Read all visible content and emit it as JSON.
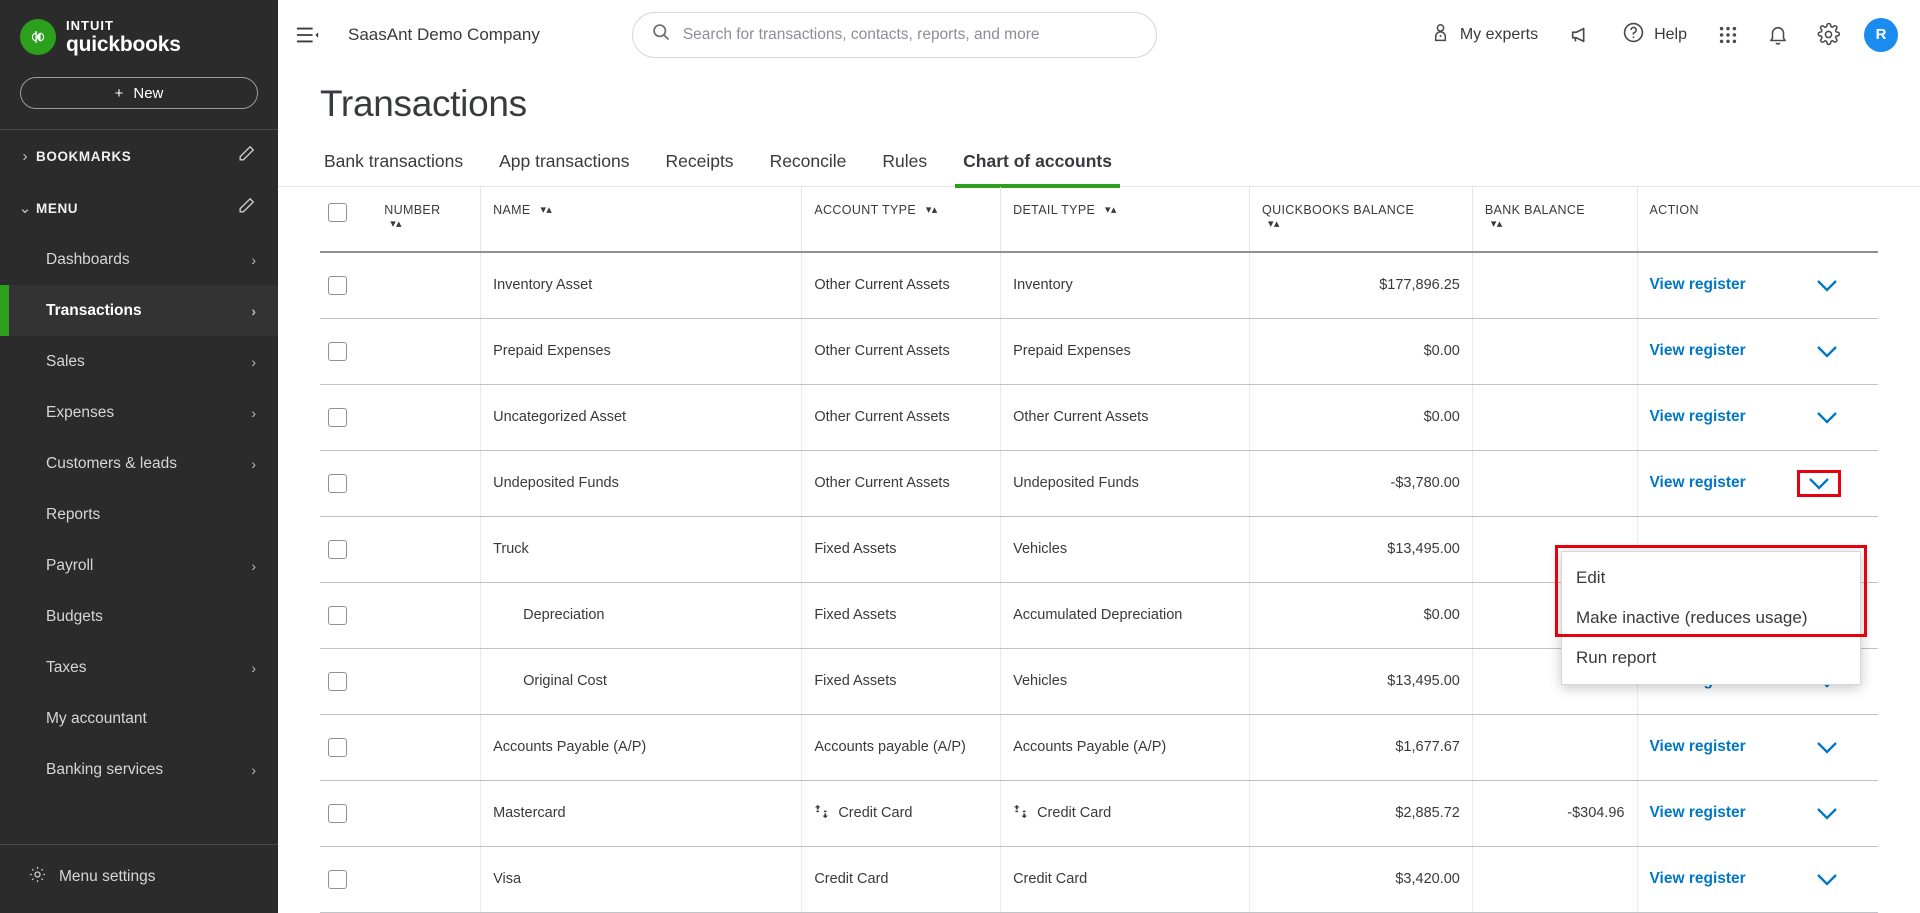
{
  "sidebar": {
    "brand": {
      "intuit": "INTUIT",
      "product": "quickbooks"
    },
    "new_button": "New",
    "groups": [
      {
        "label": "BOOKMARKS",
        "expanded": false,
        "icon": "chevron-right-icon",
        "edit_icon": "pencil-icon"
      },
      {
        "label": "MENU",
        "expanded": true,
        "icon": "chevron-down-icon",
        "edit_icon": "pencil-icon"
      }
    ],
    "items": [
      {
        "label": "Dashboards",
        "active": false,
        "has_chevron": true
      },
      {
        "label": "Transactions",
        "active": true,
        "has_chevron": true
      },
      {
        "label": "Sales",
        "active": false,
        "has_chevron": true
      },
      {
        "label": "Expenses",
        "active": false,
        "has_chevron": true
      },
      {
        "label": "Customers & leads",
        "active": false,
        "has_chevron": true
      },
      {
        "label": "Reports",
        "active": false,
        "has_chevron": false
      },
      {
        "label": "Payroll",
        "active": false,
        "has_chevron": true
      },
      {
        "label": "Budgets",
        "active": false,
        "has_chevron": false
      },
      {
        "label": "Taxes",
        "active": false,
        "has_chevron": true
      },
      {
        "label": "My accountant",
        "active": false,
        "has_chevron": false
      },
      {
        "label": "Banking services",
        "active": false,
        "has_chevron": true
      }
    ],
    "footer": {
      "label": "Menu settings",
      "icon": "gear-icon"
    },
    "accent_color": "#2CA01C",
    "background_color": "#2b2b2b"
  },
  "topbar": {
    "menu_toggle_icon": "hamburger-collapse-icon",
    "company_name": "SaasAnt Demo Company",
    "search": {
      "placeholder": "Search for transactions, contacts, reports, and more",
      "value": "",
      "icon": "search-icon"
    },
    "my_experts": {
      "label": "My experts",
      "icon": "person-icon"
    },
    "megaphone_icon": "megaphone-icon",
    "help": {
      "label": "Help",
      "icon": "question-circle-icon"
    },
    "apps_icon": "grid-apps-icon",
    "notifications_icon": "bell-icon",
    "settings_icon": "gear-icon",
    "avatar": {
      "initial": "R",
      "color": "#1a8cf0"
    }
  },
  "page": {
    "title": "Transactions"
  },
  "tabs": [
    {
      "label": "Bank transactions",
      "active": false
    },
    {
      "label": "App transactions",
      "active": false
    },
    {
      "label": "Receipts",
      "active": false
    },
    {
      "label": "Reconcile",
      "active": false
    },
    {
      "label": "Rules",
      "active": false
    },
    {
      "label": "Chart of accounts",
      "active": true
    }
  ],
  "table": {
    "select_all_checkbox": false,
    "columns": [
      {
        "key": "checkbox",
        "label": ""
      },
      {
        "key": "number",
        "label": "NUMBER",
        "sortable": true
      },
      {
        "key": "name",
        "label": "NAME",
        "sortable": true
      },
      {
        "key": "account_type",
        "label": "ACCOUNT TYPE",
        "sortable": true
      },
      {
        "key": "detail_type",
        "label": "DETAIL TYPE",
        "sortable": true
      },
      {
        "key": "quickbooks_balance",
        "label": "QUICKBOOKS BALANCE",
        "sortable": true
      },
      {
        "key": "bank_balance",
        "label": "BANK BALANCE",
        "sortable": true
      },
      {
        "key": "action",
        "label": "ACTION",
        "sortable": false
      }
    ],
    "action_link_label": "View register",
    "rows": [
      {
        "number": "",
        "name": "Inventory Asset",
        "indent": false,
        "account_type": "Other Current Assets",
        "account_type_icon": "",
        "detail_type": "Inventory",
        "detail_type_icon": "",
        "quickbooks_balance": "$177,896.25",
        "bank_balance": ""
      },
      {
        "number": "",
        "name": "Prepaid Expenses",
        "indent": false,
        "account_type": "Other Current Assets",
        "account_type_icon": "",
        "detail_type": "Prepaid Expenses",
        "detail_type_icon": "",
        "quickbooks_balance": "$0.00",
        "bank_balance": ""
      },
      {
        "number": "",
        "name": "Uncategorized Asset",
        "indent": false,
        "account_type": "Other Current Assets",
        "account_type_icon": "",
        "detail_type": "Other Current Assets",
        "detail_type_icon": "",
        "quickbooks_balance": "$0.00",
        "bank_balance": ""
      },
      {
        "number": "",
        "name": "Undeposited Funds",
        "indent": false,
        "account_type": "Other Current Assets",
        "account_type_icon": "",
        "detail_type": "Undeposited Funds",
        "detail_type_icon": "",
        "quickbooks_balance": "-$3,780.00",
        "bank_balance": ""
      },
      {
        "number": "",
        "name": "Truck",
        "indent": false,
        "account_type": "Fixed Assets",
        "account_type_icon": "",
        "detail_type": "Vehicles",
        "detail_type_icon": "",
        "quickbooks_balance": "$13,495.00",
        "bank_balance": ""
      },
      {
        "number": "",
        "name": "Depreciation",
        "indent": true,
        "account_type": "Fixed Assets",
        "account_type_icon": "",
        "detail_type": "Accumulated Depreciation",
        "detail_type_icon": "",
        "quickbooks_balance": "$0.00",
        "bank_balance": ""
      },
      {
        "number": "",
        "name": "Original Cost",
        "indent": true,
        "account_type": "Fixed Assets",
        "account_type_icon": "",
        "detail_type": "Vehicles",
        "detail_type_icon": "",
        "quickbooks_balance": "$13,495.00",
        "bank_balance": ""
      },
      {
        "number": "",
        "name": "Accounts Payable (A/P)",
        "indent": false,
        "account_type": "Accounts payable (A/P)",
        "account_type_icon": "",
        "detail_type": "Accounts Payable (A/P)",
        "detail_type_icon": "",
        "quickbooks_balance": "$1,677.67",
        "bank_balance": ""
      },
      {
        "number": "",
        "name": "Mastercard",
        "indent": false,
        "account_type": "Credit Card",
        "account_type_icon": "bank-connect-icon",
        "detail_type": "Credit Card",
        "detail_type_icon": "bank-connect-icon",
        "quickbooks_balance": "$2,885.72",
        "bank_balance": "-$304.96"
      },
      {
        "number": "",
        "name": "Visa",
        "indent": false,
        "account_type": "Credit Card",
        "account_type_icon": "",
        "detail_type": "Credit Card",
        "detail_type_icon": "",
        "quickbooks_balance": "$3,420.00",
        "bank_balance": ""
      }
    ]
  },
  "dropdown": {
    "open_for_row": "Undeposited Funds",
    "items": [
      {
        "label": "Edit",
        "highlighted": true
      },
      {
        "label": "Make inactive (reduces usage)",
        "highlighted": true
      },
      {
        "label": "Run report",
        "highlighted": false
      }
    ],
    "highlight_color": "#e8000d"
  }
}
